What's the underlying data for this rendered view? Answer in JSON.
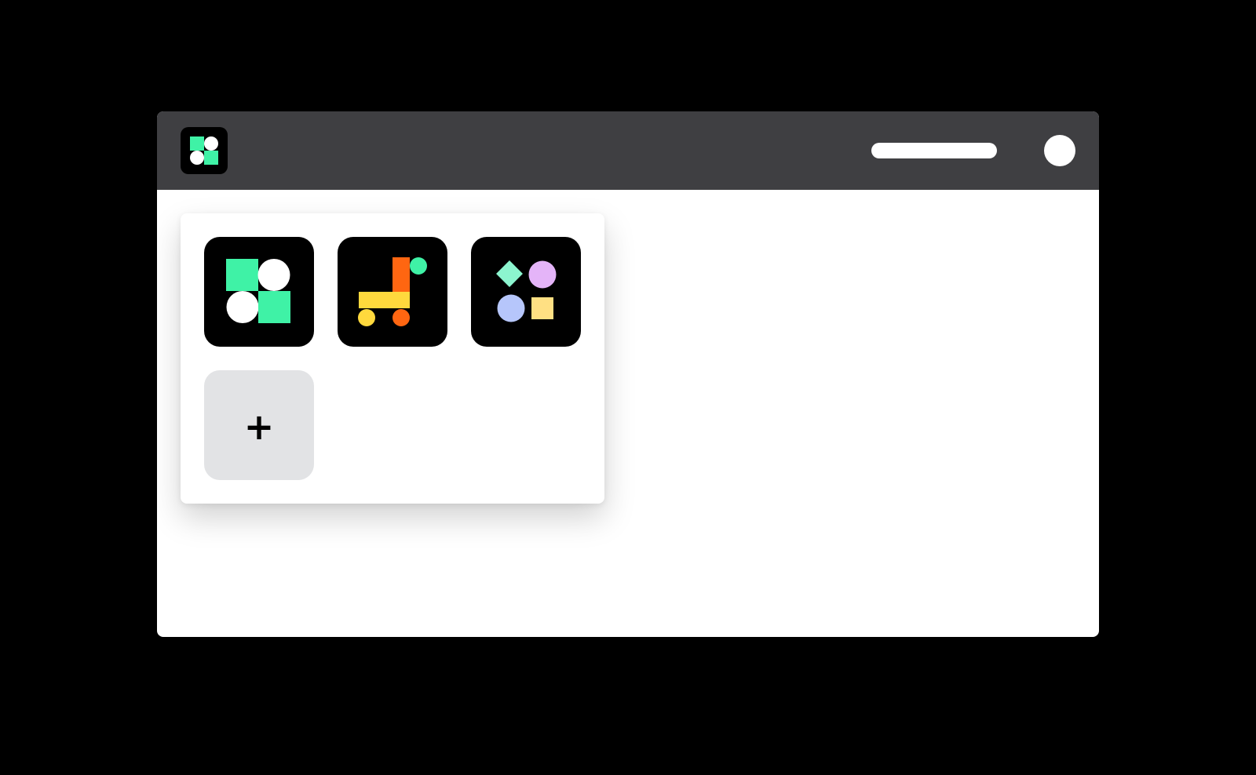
{
  "header": {
    "logo_icon": "app-logo-icon",
    "search_bar": {
      "value": "",
      "placeholder": ""
    },
    "avatar_icon": "user-avatar-icon"
  },
  "app_switcher": {
    "apps": [
      {
        "icon": "shapes-grid-app-icon",
        "colors": [
          "#3ff2a6",
          "#ffffff"
        ]
      },
      {
        "icon": "shapes-cart-app-icon",
        "colors": [
          "#ff6611",
          "#ffd93d",
          "#3ff2a6"
        ]
      },
      {
        "icon": "shapes-pastel-app-icon",
        "colors": [
          "#8cf5cf",
          "#e4b4f8",
          "#b6c6fb",
          "#ffe083"
        ]
      }
    ],
    "add_button": {
      "label": "+"
    }
  },
  "colors": {
    "background": "#000000",
    "topbar": "#3f3f42",
    "window": "#ffffff",
    "add_tile": "#e2e3e5",
    "accent_green": "#3ff2a6"
  }
}
